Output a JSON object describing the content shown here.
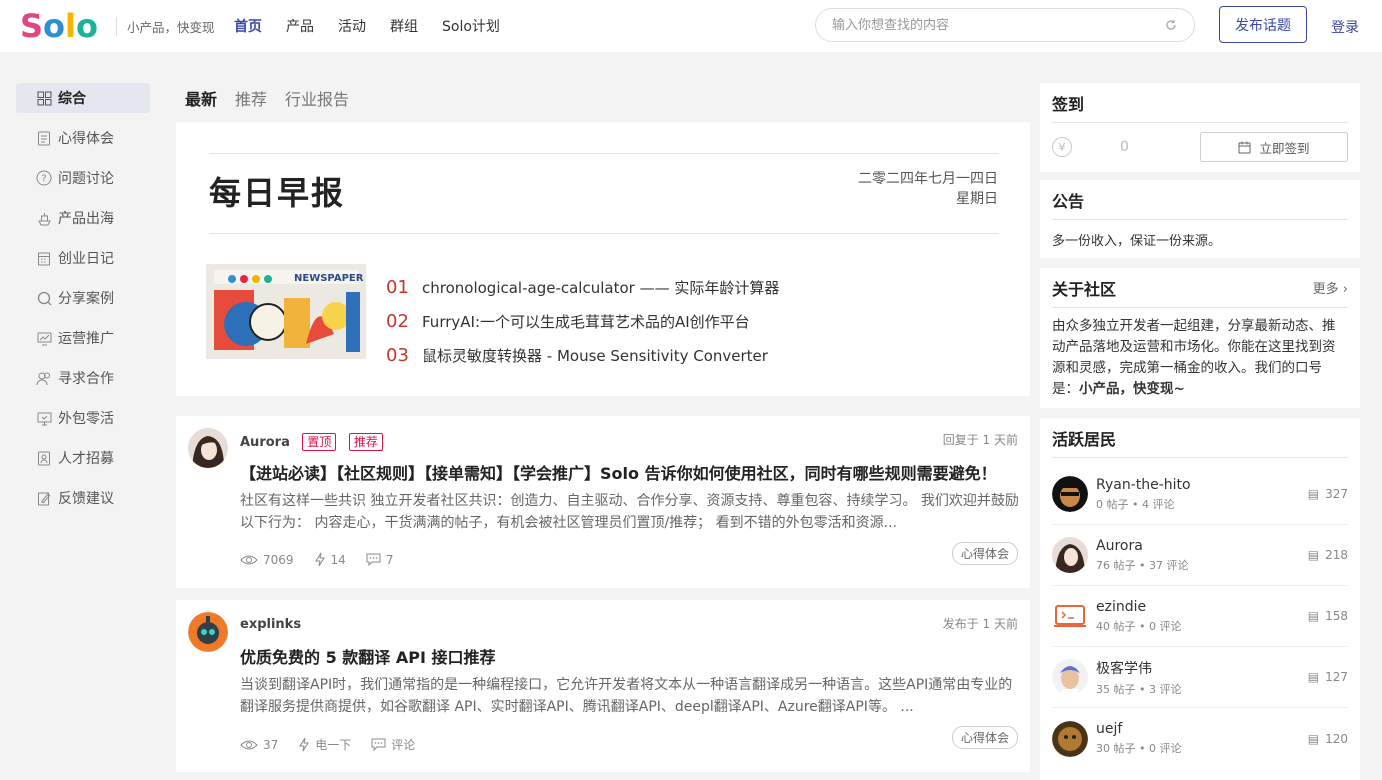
{
  "header": {
    "logo_letters": [
      "S",
      "o",
      "l",
      "o"
    ],
    "tagline": "小产品，快变现",
    "nav": [
      "首页",
      "产品",
      "活动",
      "群组",
      "Solo计划"
    ],
    "search_placeholder": "输入你想查找的内容",
    "publish_label": "发布话题",
    "login_label": "登录"
  },
  "sidebar": {
    "items": [
      {
        "label": "综合",
        "icon": "grid-icon"
      },
      {
        "label": "心得体会",
        "icon": "document-icon"
      },
      {
        "label": "问题讨论",
        "icon": "question-icon"
      },
      {
        "label": "产品出海",
        "icon": "ship-icon"
      },
      {
        "label": "创业日记",
        "icon": "calendar-icon"
      },
      {
        "label": "分享案例",
        "icon": "search-icon"
      },
      {
        "label": "运营推广",
        "icon": "chart-icon"
      },
      {
        "label": "寻求合作",
        "icon": "users-icon"
      },
      {
        "label": "外包零活",
        "icon": "monitor-icon"
      },
      {
        "label": "人才招募",
        "icon": "badge-icon"
      },
      {
        "label": "反馈建议",
        "icon": "edit-icon"
      }
    ]
  },
  "tabs": [
    "最新",
    "推荐",
    "行业报告"
  ],
  "daily": {
    "title": "每日早报",
    "date": "二零二四年七月一四日",
    "weekday": "星期日",
    "thumb_text": "NEWSPAPER",
    "items": [
      {
        "num": "01",
        "text": "chronological-age-calculator —— 实际年龄计算器"
      },
      {
        "num": "02",
        "text": "FurryAI:一个可以生成毛茸茸艺术品的AI创作平台"
      },
      {
        "num": "03",
        "text": "鼠标灵敏度转换器 - Mouse Sensitivity Converter"
      }
    ]
  },
  "posts": [
    {
      "author": "Aurora",
      "badges": [
        "置顶",
        "推荐"
      ],
      "time": "回复于 1 天前",
      "title": "【进站必读】【社区规则】【接单需知】【学会推广】Solo 告诉你如何使用社区，同时有哪些规则需要避免！",
      "excerpt": "社区有这样一些共识 独立开发者社区共识：创造力、自主驱动、合作分享、资源支持、尊重包容、持续学习。 我们欢迎并鼓励以下行为： 内容走心，干货满满的帖子，有机会被社区管理员们置顶/推荐； 看到不错的外包零活和资源...",
      "views": "7069",
      "likes": "14",
      "comments": "7",
      "tag": "心得体会"
    },
    {
      "author": "explinks",
      "badges": [],
      "time": "发布于 1 天前",
      "title": "优质免费的 5 款翻译 API 接口推荐",
      "excerpt": "当谈到翻译API时，我们通常指的是一种编程接口，它允许开发者将文本从一种语言翻译成另一种语言。这些API通常由专业的翻译服务提供商提供，如谷歌翻译 API、实时翻译API、腾讯翻译API、deepl翻译API、Azure翻译API等。 ...",
      "views": "37",
      "likes": "电一下",
      "comments": "评论",
      "tag": "心得体会"
    }
  ],
  "right": {
    "checkin": {
      "title": "签到",
      "points": "0",
      "button": "立即签到",
      "coin": "¥"
    },
    "notice": {
      "title": "公告",
      "text": "多一份收入，保证一份来源。"
    },
    "about": {
      "title": "关于社区",
      "more": "更多",
      "text": "由众多独立开发者一起组建，分享最新动态、推动产品落地及运营和市场化。你能在这里找到资源和灵感，完成第一桶金的收入。我们的口号是：",
      "slogan": "小产品，快变现~"
    },
    "residents": {
      "title": "活跃居民",
      "list": [
        {
          "name": "Ryan-the-hito",
          "stats": "0 帖子 • 4 评论",
          "count": "327"
        },
        {
          "name": "Aurora",
          "stats": "76 帖子 • 37 评论",
          "count": "218"
        },
        {
          "name": "ezindie",
          "stats": "40 帖子 • 0 评论",
          "count": "158"
        },
        {
          "name": "极客学伟",
          "stats": "35 帖子 • 3 评论",
          "count": "127"
        },
        {
          "name": "uejf",
          "stats": "30 帖子 • 0 评论",
          "count": "120"
        }
      ]
    }
  },
  "colors": {
    "brand": "#3b48a5",
    "accent_red": "#c0392b",
    "logo_pink": "#e2457f",
    "logo_blue": "#2f8fd5",
    "logo_teal": "#1bb39a"
  }
}
